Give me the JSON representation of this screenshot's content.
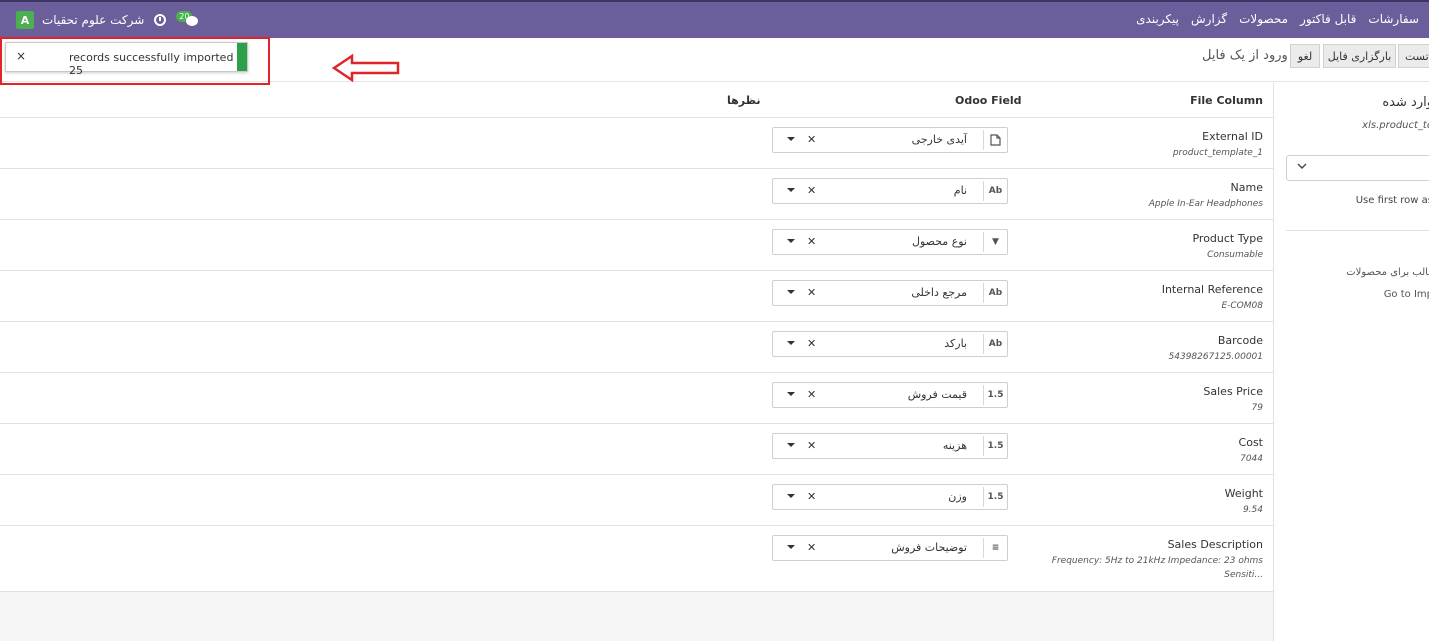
{
  "navbar": {
    "avatar_letter": "A",
    "company": "شرکت علوم تحقیات",
    "chat_count": "20",
    "menu": [
      "سفارشات",
      "قابل فاکتور",
      "محصولات",
      "گزارش",
      "پیکربندی"
    ]
  },
  "controls": {
    "test_label": "تست",
    "reload_label": "بارگزاری فایل",
    "cancel_label": "لغو",
    "title": "ورود از یک فایل"
  },
  "toast": {
    "close_label": "×",
    "message": "records successfully imported 25"
  },
  "table": {
    "headers": {
      "file_column": "File Column",
      "odoo_field": "Odoo Field",
      "notes": "نظرها"
    },
    "rows": [
      {
        "name": "External ID",
        "sample": "product_template_1",
        "field": "آیدی خارجی",
        "type": "doc"
      },
      {
        "name": "Name",
        "sample": "Apple In-Ear Headphones",
        "field": "نام",
        "type": "Ab"
      },
      {
        "name": "Product Type",
        "sample": "Consumable",
        "field": "نوع محصول",
        "type": "▼"
      },
      {
        "name": "Internal Reference",
        "sample": "E-COM08",
        "field": "مرجع داخلی",
        "type": "Ab"
      },
      {
        "name": "Barcode",
        "sample": "54398267125.00001",
        "field": "بارکد",
        "type": "Ab"
      },
      {
        "name": "Sales Price",
        "sample": "79",
        "field": "قیمت فروش",
        "type": "1.5"
      },
      {
        "name": "Cost",
        "sample": "7044",
        "field": "هزینه",
        "type": "1.5"
      },
      {
        "name": "Weight",
        "sample": "9.54",
        "field": "وزن",
        "type": "1.5"
      },
      {
        "name": "Sales Description",
        "sample": "Frequency: 5Hz to 21kHz Impedance: 23 ohms",
        "sample2": "Sensiti...",
        "field": "توضیحات فروش",
        "type": "≡"
      }
    ]
  },
  "sidebar": {
    "title": "وارد شده",
    "file_name": "xls.product_te",
    "first_row_label": "Use first row as",
    "template_label": "قالب برای محصولات",
    "goto_label": "Go to Imp"
  }
}
